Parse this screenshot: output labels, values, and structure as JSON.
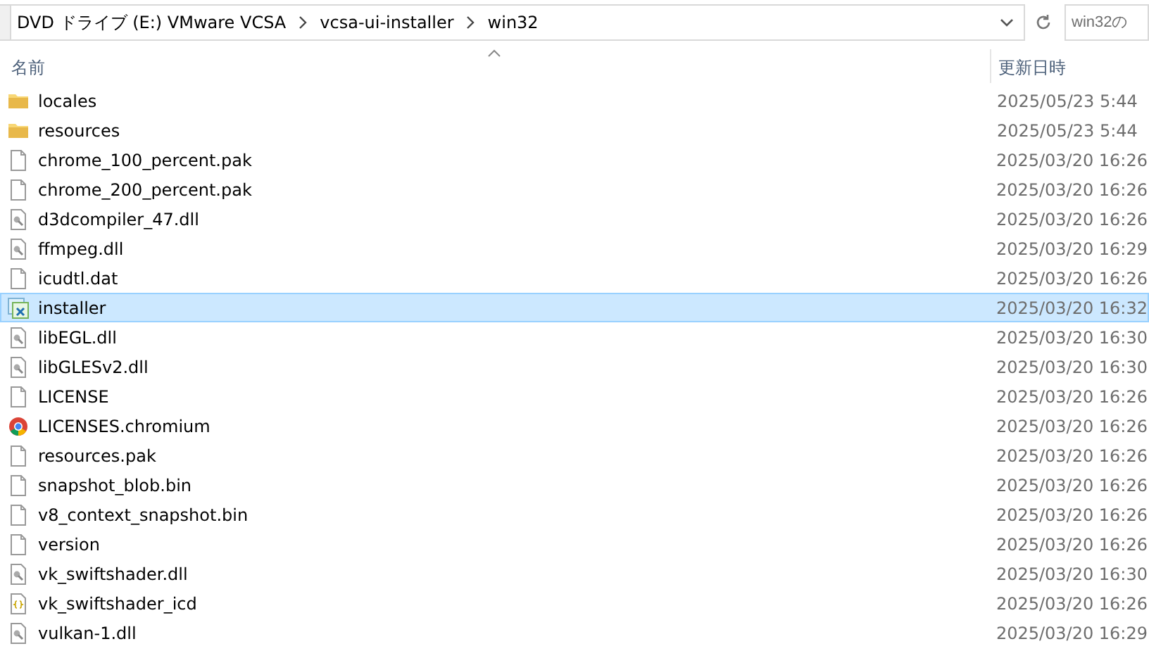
{
  "address_bar": {
    "crumbs": [
      "DVD ドライブ (E:) VMware VCSA",
      "vcsa-ui-installer",
      "win32"
    ]
  },
  "search": {
    "placeholder": "win32の"
  },
  "columns": [
    "名前",
    "更新日時"
  ],
  "rows": [
    {
      "name": "locales",
      "modified": "2025/05/23 5:44",
      "kind": "folder",
      "selected": false
    },
    {
      "name": "resources",
      "modified": "2025/05/23 5:44",
      "kind": "folder",
      "selected": false
    },
    {
      "name": "chrome_100_percent.pak",
      "modified": "2025/03/20 16:26",
      "kind": "file",
      "selected": false
    },
    {
      "name": "chrome_200_percent.pak",
      "modified": "2025/03/20 16:26",
      "kind": "file",
      "selected": false
    },
    {
      "name": "d3dcompiler_47.dll",
      "modified": "2025/03/20 16:26",
      "kind": "dll",
      "selected": false
    },
    {
      "name": "ffmpeg.dll",
      "modified": "2025/03/20 16:29",
      "kind": "dll",
      "selected": false
    },
    {
      "name": "icudtl.dat",
      "modified": "2025/03/20 16:26",
      "kind": "file",
      "selected": false
    },
    {
      "name": "installer",
      "modified": "2025/03/20 16:32",
      "kind": "app",
      "selected": true
    },
    {
      "name": "libEGL.dll",
      "modified": "2025/03/20 16:30",
      "kind": "dll",
      "selected": false
    },
    {
      "name": "libGLESv2.dll",
      "modified": "2025/03/20 16:30",
      "kind": "dll",
      "selected": false
    },
    {
      "name": "LICENSE",
      "modified": "2025/03/20 16:26",
      "kind": "file",
      "selected": false
    },
    {
      "name": "LICENSES.chromium",
      "modified": "2025/03/20 16:26",
      "kind": "browser",
      "selected": false
    },
    {
      "name": "resources.pak",
      "modified": "2025/03/20 16:26",
      "kind": "file",
      "selected": false
    },
    {
      "name": "snapshot_blob.bin",
      "modified": "2025/03/20 16:26",
      "kind": "file",
      "selected": false
    },
    {
      "name": "v8_context_snapshot.bin",
      "modified": "2025/03/20 16:26",
      "kind": "file",
      "selected": false
    },
    {
      "name": "version",
      "modified": "2025/03/20 16:26",
      "kind": "file",
      "selected": false
    },
    {
      "name": "vk_swiftshader.dll",
      "modified": "2025/03/20 16:30",
      "kind": "dll",
      "selected": false
    },
    {
      "name": "vk_swiftshader_icd",
      "modified": "2025/03/20 16:26",
      "kind": "json",
      "selected": false
    },
    {
      "name": "vulkan-1.dll",
      "modified": "2025/03/20 16:29",
      "kind": "dll",
      "selected": false
    }
  ]
}
